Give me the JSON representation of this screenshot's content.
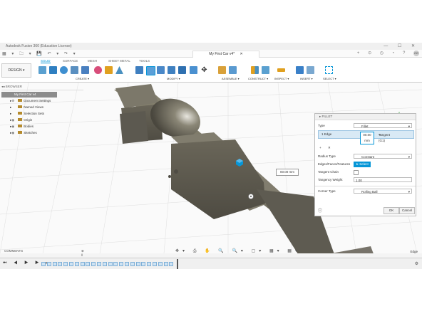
{
  "window": {
    "title": "Autodesk Fusion 360 (Education License)",
    "controls": "—  ☐  ✕"
  },
  "quick_access": "▦ ▾ 🗀 ▾ 💾 ↶ ▾ ↷ ▾",
  "document_tab": {
    "title": "My First Car v4*",
    "close": "✕"
  },
  "header_icons": "+ ⊙ ◷ ◔ ?",
  "user_initials": "CC",
  "workspace": {
    "label": "DESIGN ▾"
  },
  "tabs": [
    "SOLID",
    "SURFACE",
    "MESH",
    "SHEET METAL",
    "TOOLS"
  ],
  "active_tab": "SOLID",
  "tool_groups": [
    {
      "label": "CREATE ▾"
    },
    {
      "label": "MODIFY ▾"
    },
    {
      "label": "ASSEMBLE ▾"
    },
    {
      "label": "CONSTRUCT ▾"
    },
    {
      "label": "INSPECT ▾"
    },
    {
      "label": "INSERT ▾"
    },
    {
      "label": "SELECT ▾"
    }
  ],
  "browser": {
    "header": "BROWSER",
    "root": "My First Car v4",
    "items": [
      "Document Settings",
      "Named Views",
      "Selection Sets",
      "Origin",
      "Bodies",
      "Sketches"
    ]
  },
  "fillet": {
    "header": "FILLET",
    "type_label": "Type",
    "type_value": "Fillet",
    "edge_label": "1 Edge",
    "edge_value": "00.00 mm",
    "tangent_label": "Tangent (G1)",
    "radius_type_label": "Radius Type",
    "radius_type_value": "Constant",
    "edges_label": "Edges/Faces/Features",
    "select_label": "Select",
    "tangent_chain_label": "Tangent Chain",
    "tangency_weight_label": "Tangency Weight",
    "tangency_weight_value": "1.00",
    "corner_type_label": "Corner Type",
    "corner_type_value": "Rolling Ball",
    "ok_label": "OK",
    "cancel_label": "Cancel"
  },
  "dimension_input": "00.00 mm",
  "comments": {
    "label": "COMMENTS",
    "add": "⊕ ‖"
  },
  "navigation": "✥▾ ⎙ ✋ 🔍 🔍▾ ▢▾ ▦▾ ▦▾",
  "selection_status": "Edge",
  "timeline": {
    "controls": "⏮ ◀ ▶ ▶ ⏭",
    "feature_count": 24
  },
  "colors": {
    "accent": "#0696d7",
    "body": "#6e6a5f",
    "select_btn": "#0696d7"
  }
}
